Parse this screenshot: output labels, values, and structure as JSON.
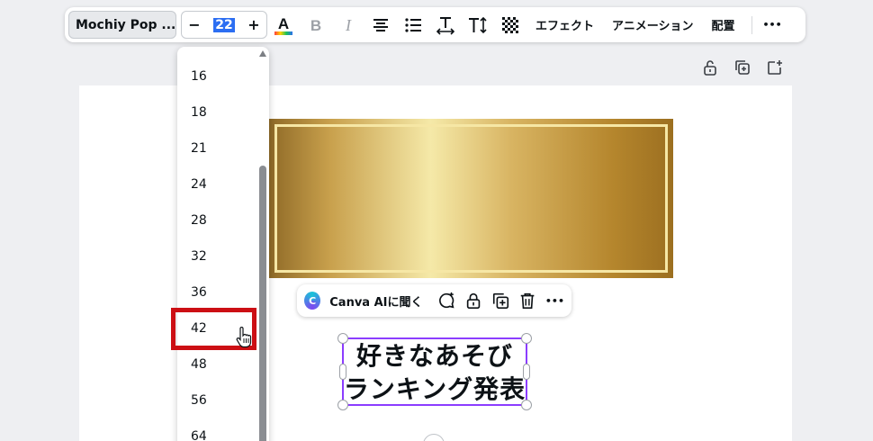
{
  "toolbar": {
    "font_name": "Mochiy Pop ...",
    "size_minus": "−",
    "size_value": "22",
    "size_plus": "+",
    "effects_label": "エフェクト",
    "animation_label": "アニメーション",
    "position_label": "配置",
    "more_label": "•••"
  },
  "dropdown": {
    "items": [
      "16",
      "18",
      "21",
      "24",
      "28",
      "32",
      "36",
      "42",
      "48",
      "56",
      "64"
    ],
    "highlighted": "42"
  },
  "mini_toolbar": {
    "ai_label": "Canva AIに聞く",
    "more_label": "•••"
  },
  "canvas": {
    "text_line1": "好きなあそび",
    "text_line2": "ランキング発表"
  },
  "colors": {
    "accent": "#8b3dff",
    "highlight": "#cc0f14",
    "selection_blue": "#2c6ef2"
  }
}
